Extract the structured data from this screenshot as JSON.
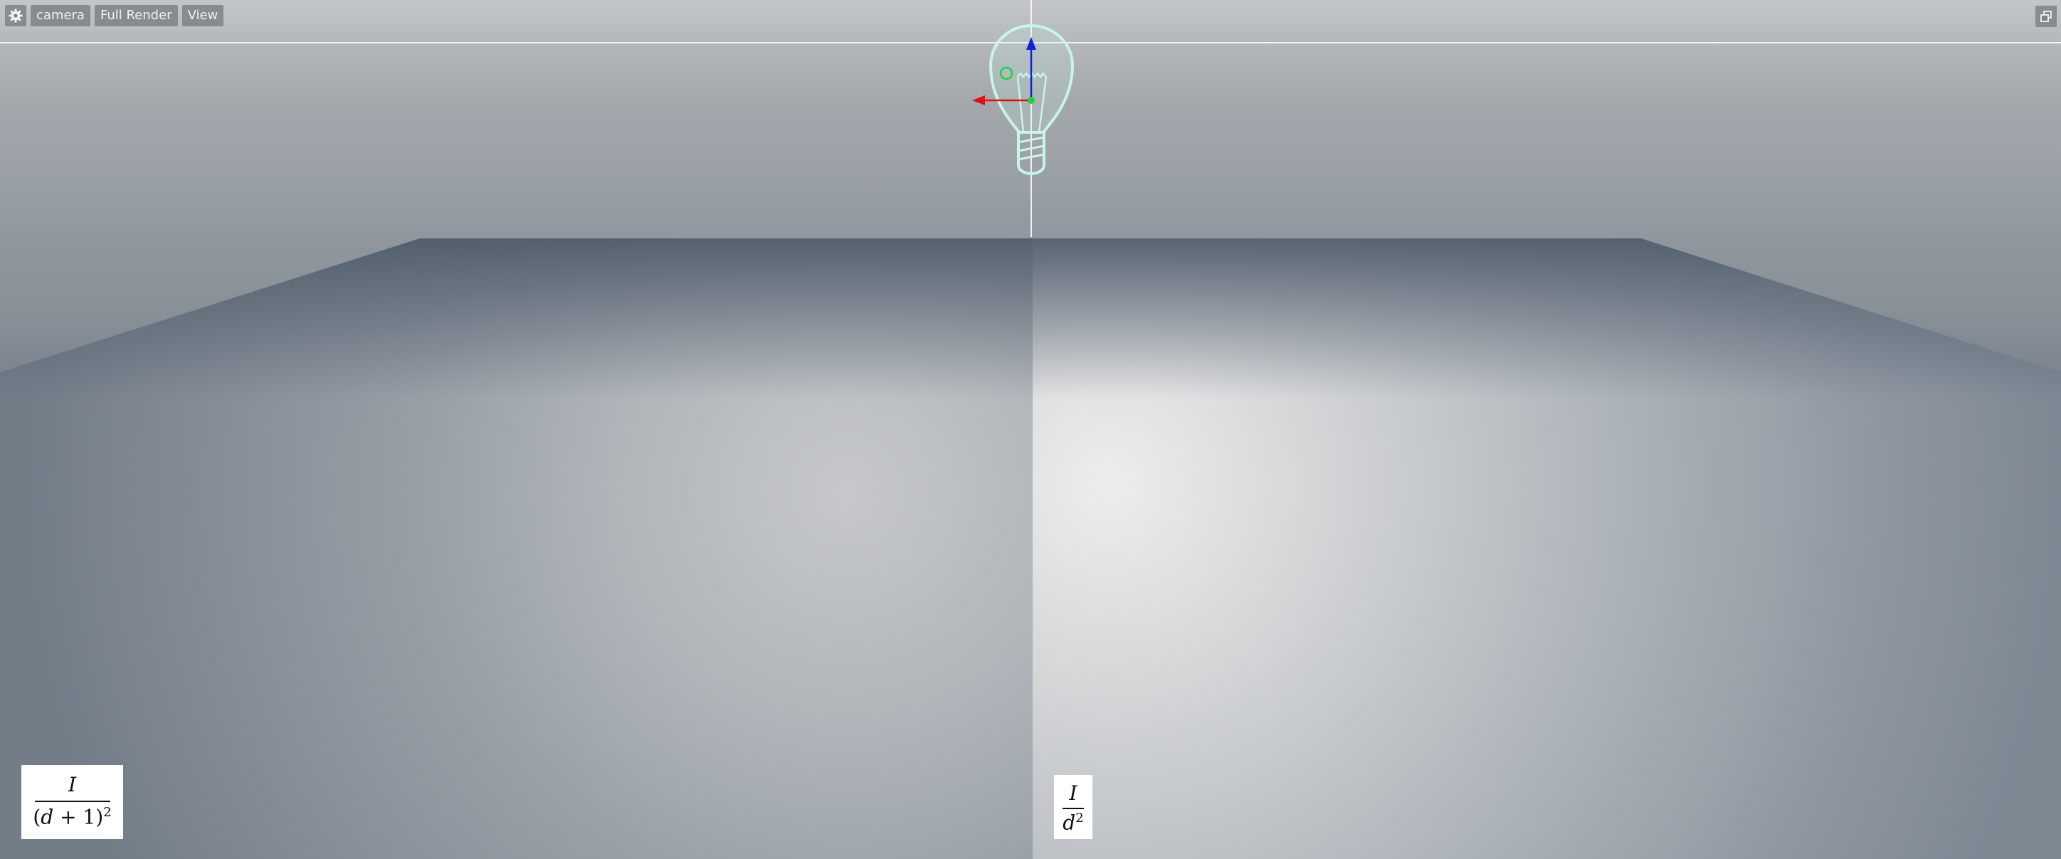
{
  "toolbar": {
    "settings_icon": "gear-icon",
    "camera_label": "camera",
    "render_label": "Full Render",
    "view_label": "View"
  },
  "window": {
    "maximize_icon": "restore-window-icon"
  },
  "scene": {
    "light_icon": "light-bulb-icon",
    "light_color": "#c9f5e6",
    "axis_colors": {
      "x": "#e01010",
      "y": "#1020d8",
      "z": "#20d040"
    }
  },
  "formulas": {
    "left": {
      "numerator": "I",
      "den_open": "(",
      "den_var": "d",
      "den_op": " + 1",
      "den_close": ")",
      "exponent": "2"
    },
    "right": {
      "numerator": "I",
      "den_var": "d",
      "exponent": "2"
    }
  }
}
